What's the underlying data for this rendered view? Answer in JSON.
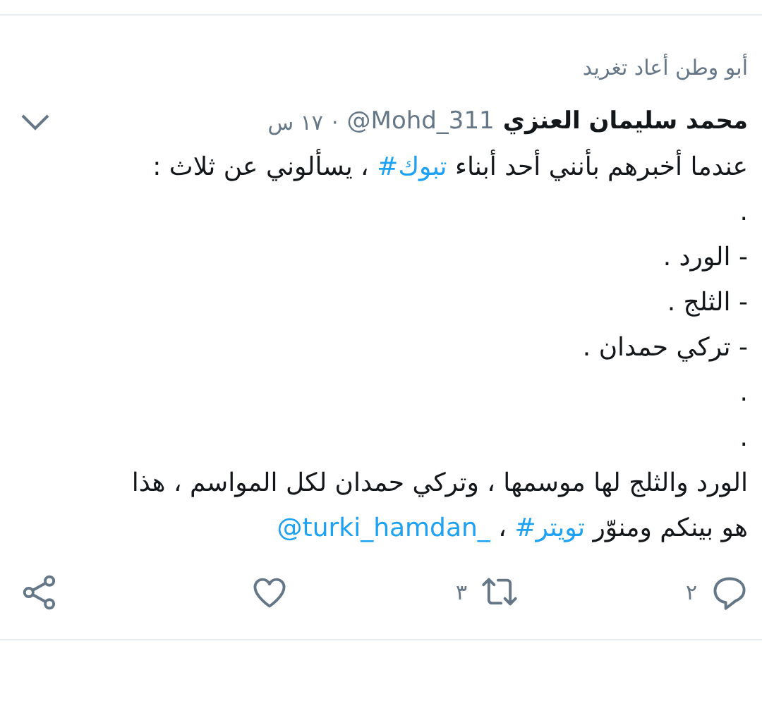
{
  "retweeted_by": "أبو وطن أعاد تغريد",
  "author": {
    "name": "محمد سليمان العنزي",
    "handle": "@Mohd_311",
    "separator": "·",
    "time": "١٧ س"
  },
  "body": [
    [
      {
        "kind": "text",
        "text": "عندما أخبرهم بأنني أحد أبناء "
      },
      {
        "kind": "hashtag",
        "text": "#تبوك"
      },
      {
        "kind": "text",
        "text": " ، يسألوني عن ثلاث :"
      }
    ],
    [
      {
        "kind": "text",
        "text": "."
      }
    ],
    [
      {
        "kind": "text",
        "text": "- الورد ."
      }
    ],
    [
      {
        "kind": "text",
        "text": "- الثلج ."
      }
    ],
    [
      {
        "kind": "text",
        "text": "- تركي حمدان ."
      }
    ],
    [
      {
        "kind": "text",
        "text": "."
      }
    ],
    [
      {
        "kind": "text",
        "text": "."
      }
    ],
    [
      {
        "kind": "text",
        "text": "الورد والثلج لها موسمها ، وتركي حمدان لكل المواسم ، هذا"
      }
    ],
    [
      {
        "kind": "text",
        "text": "هو بينكم ومنوّر "
      },
      {
        "kind": "hashtag",
        "text": "#تويتر"
      },
      {
        "kind": "text",
        "text": " ، "
      },
      {
        "kind": "mention",
        "text": "@turki_hamdan_"
      }
    ]
  ],
  "actions": [
    {
      "kind": "reply",
      "count": "٢"
    },
    {
      "kind": "retweet",
      "count": "٣"
    },
    {
      "kind": "like"
    },
    {
      "kind": "share"
    }
  ]
}
